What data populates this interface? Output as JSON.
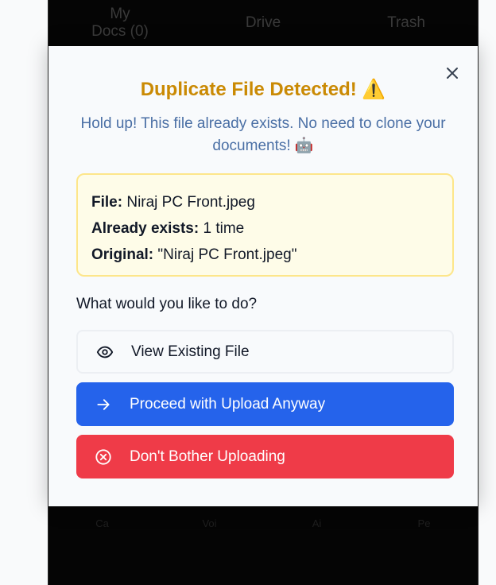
{
  "background_tabs": [
    "My\nDocs (0)",
    "Drive",
    "Trash"
  ],
  "background_nav": [
    "Ca",
    "Voi",
    "Ai",
    "Pe"
  ],
  "modal": {
    "title": "Duplicate File Detected! ⚠️",
    "subtitle": "Hold up! This file already exists. No need to clone your documents! 🤖",
    "info": {
      "file_label": "File:",
      "file_value": "Niraj PC Front.jpeg",
      "exists_label": "Already exists:",
      "exists_value": "1 time",
      "original_label": "Original:",
      "original_value": "\"Niraj PC Front.jpeg\""
    },
    "question": "What would you like to do?",
    "actions": [
      {
        "label": "View Existing File",
        "icon": "eye-icon"
      },
      {
        "label": "Proceed with Upload Anyway",
        "icon": "arrow-right-icon"
      },
      {
        "label": "Don't Bother Uploading",
        "icon": "x-circle-icon"
      }
    ]
  },
  "colors": {
    "title": "#ca8a04",
    "subtitle": "#4a6fa5",
    "info_bg": "#fefce8",
    "info_border": "#fde68a",
    "proceed": "#2563eb",
    "cancel": "#ef3b48"
  }
}
